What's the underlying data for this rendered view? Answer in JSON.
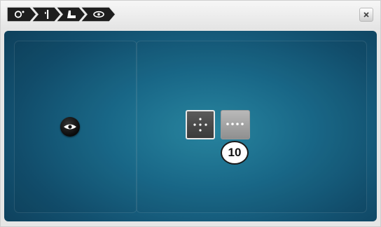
{
  "toolbar": {
    "breadcrumbs": [
      {
        "icon": "needle-eye-icon"
      },
      {
        "icon": "needle-icon"
      },
      {
        "icon": "presser-foot-icon"
      },
      {
        "icon": "eye-icon"
      }
    ],
    "close_icon": "close-icon"
  },
  "left_panel": {
    "button_icon": "eye-icon"
  },
  "right_panel": {
    "options": [
      {
        "icon": "dots-cross-icon",
        "selected": true
      },
      {
        "icon": "dots-row-icon",
        "selected": false
      }
    ],
    "callout": "10"
  },
  "colors": {
    "background_center": "#2a8aa6",
    "background_edge": "#0d3d58",
    "toolbar": "#eeeeee",
    "crumb": "#1f1f1f"
  }
}
